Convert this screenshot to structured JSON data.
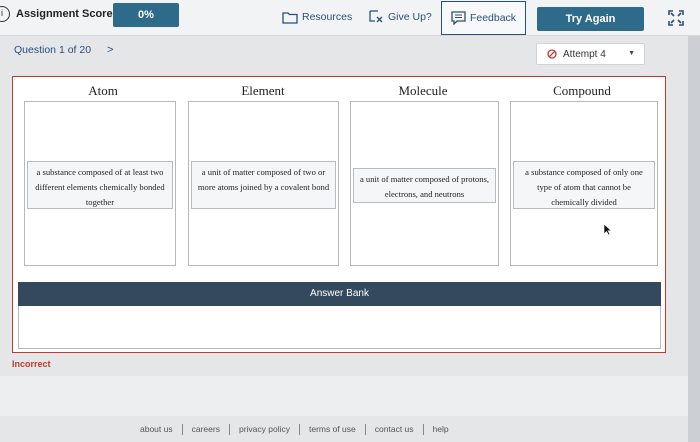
{
  "header": {
    "score_label": "Assignment Score:",
    "score_value": "0%",
    "resources_label": "Resources",
    "giveup_label": "Give Up?",
    "feedback_label": "Feedback",
    "try_again_label": "Try Again",
    "info_glyph": "i"
  },
  "question": {
    "nav_label": "Question 1 of 20",
    "next_glyph": ">",
    "attempt_label": "Attempt 4"
  },
  "categories": [
    {
      "title": "Atom",
      "card": "a substance composed of at least two different elements chemically bonded together"
    },
    {
      "title": "Element",
      "card": "a unit of matter composed of two or more atoms joined by a covalent bond"
    },
    {
      "title": "Molecule",
      "card": "a unit of matter composed of protons, electrons, and neutrons"
    },
    {
      "title": "Compound",
      "card": "a substance composed of only one type of atom that cannot be chemically divided"
    }
  ],
  "answer_bank": {
    "title": "Answer Bank"
  },
  "status": {
    "result": "Incorrect"
  },
  "footer": {
    "links": [
      "about us",
      "careers",
      "privacy policy",
      "terms of use",
      "contact us",
      "help"
    ]
  },
  "colors": {
    "primary": "#2e6b8a",
    "link": "#2a4f7a",
    "error": "#c0392b",
    "bank_header": "#34495e"
  },
  "icons": {
    "resources": "folder-icon",
    "giveup": "give-up-icon",
    "feedback": "feedback-icon",
    "attempt": "cancel-circle-icon",
    "expand": "expand-icon"
  }
}
